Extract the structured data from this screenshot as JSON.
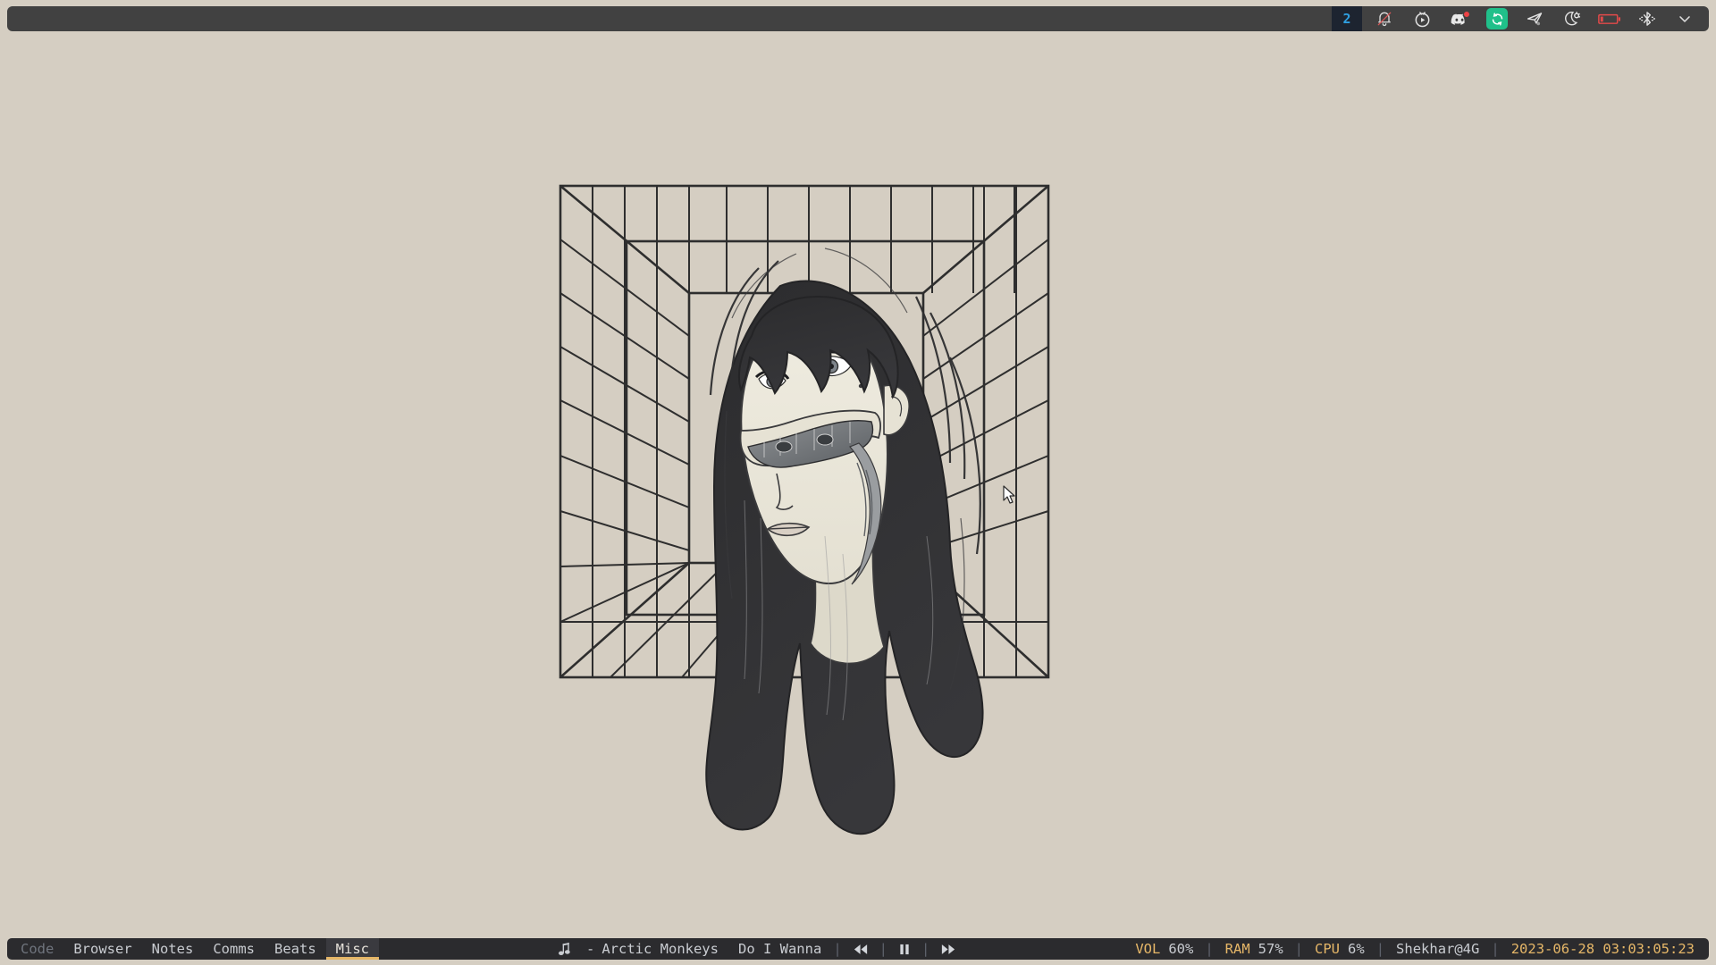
{
  "desktop": {
    "background_color": "#d5cec2",
    "wallpaper": {
      "name": "anime-portrait-wireframe-box",
      "description": "Monochrome line-art portrait of a long dark-haired woman with a cracked-open lower face revealing mechanical parts, inside nested perspective wireframe boxes",
      "ink_color": "#2e2e2e",
      "paper_color": "#e2ded1"
    }
  },
  "topbar": {
    "background_color": "#414141",
    "workspace_indicator": {
      "label": "2",
      "text_color": "#2f9fe0",
      "chip_color": "#1d2430"
    },
    "tray": [
      {
        "name": "bell-muted-icon",
        "label": "Notifications muted",
        "accent": "#d95757"
      },
      {
        "name": "alarm-play-icon",
        "label": "Media timer"
      },
      {
        "name": "discord-icon",
        "label": "Discord",
        "badge": true,
        "badge_color": "#ed4245"
      },
      {
        "name": "sync-icon",
        "label": "Sync",
        "accent": "#20c08a"
      },
      {
        "name": "telegram-send-icon",
        "label": "Telegram"
      },
      {
        "name": "night-light-icon",
        "label": "Night light"
      },
      {
        "name": "battery-low-icon",
        "label": "Battery low",
        "accent": "#e24a4a"
      },
      {
        "name": "bluetooth-icon",
        "label": "Bluetooth"
      },
      {
        "name": "chevron-down-icon",
        "label": "Show hidden tray icons"
      }
    ]
  },
  "bottombar": {
    "background_color": "#2b2b2e",
    "accent_color": "#e6b768",
    "workspaces": [
      {
        "label": "Code",
        "state": "inactive-dim"
      },
      {
        "label": "Browser",
        "state": "inactive"
      },
      {
        "label": "Notes",
        "state": "inactive"
      },
      {
        "label": "Comms",
        "state": "inactive"
      },
      {
        "label": "Beats",
        "state": "inactive"
      },
      {
        "label": "Misc",
        "state": "active"
      }
    ],
    "player": {
      "icon": "music-note-icon",
      "dash": "-",
      "artist": "Arctic Monkeys",
      "title": "Do I Wanna",
      "separator": "|",
      "controls": [
        {
          "name": "previous-track-button",
          "glyph": "◀◀"
        },
        {
          "name": "pause-button",
          "glyph": "‖"
        },
        {
          "name": "next-track-button",
          "glyph": "▶▶"
        }
      ]
    },
    "stats": [
      {
        "name": "volume",
        "label": "VOL",
        "value": "60%"
      },
      {
        "name": "memory",
        "label": "RAM",
        "value": "57%"
      },
      {
        "name": "cpu",
        "label": "CPU",
        "value": "6%"
      }
    ],
    "user": "Shekhar@4G",
    "clock": "2023-06-28 03:03:05:23"
  }
}
